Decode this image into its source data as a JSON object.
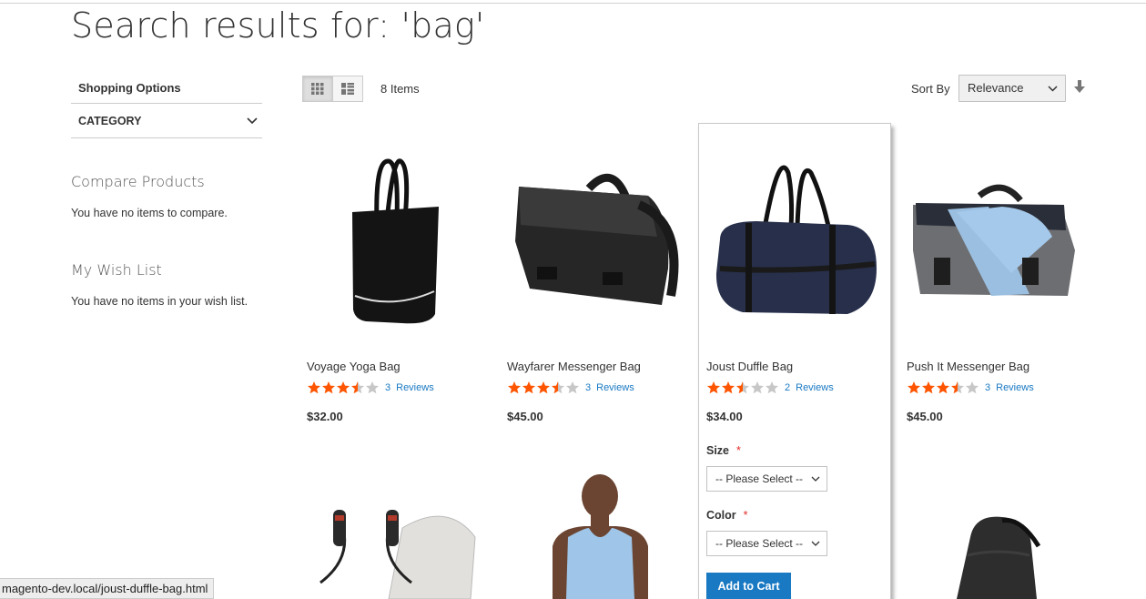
{
  "page": {
    "title": "Search results for: 'bag'"
  },
  "sidebar": {
    "shopping_options": "Shopping Options",
    "category": "CATEGORY",
    "compare": {
      "title": "Compare Products",
      "text": "You have no items to compare."
    },
    "wishlist": {
      "title": "My Wish List",
      "text": "You have no items in your wish list."
    }
  },
  "toolbar": {
    "modes": [
      "grid-icon",
      "list-icon"
    ],
    "count": "8 Items",
    "sort_label": "Sort By",
    "sort_value": "Relevance"
  },
  "products": [
    {
      "name": "Voyage Yoga Bag",
      "rating": 3.5,
      "reviews_count": "3",
      "reviews_label": "Reviews",
      "price": "$32.00",
      "image": "tote-bag"
    },
    {
      "name": "Wayfarer Messenger Bag",
      "rating": 3.5,
      "reviews_count": "3",
      "reviews_label": "Reviews",
      "price": "$45.00",
      "image": "messenger-bag-black"
    },
    {
      "name": "Joust Duffle Bag",
      "rating": 2.5,
      "reviews_count": "2",
      "reviews_label": "Reviews",
      "price": "$34.00",
      "image": "duffle-bag"
    },
    {
      "name": "Push It Messenger Bag",
      "rating": 3.5,
      "reviews_count": "3",
      "reviews_label": "Reviews",
      "price": "$45.00",
      "image": "messenger-bag-blue"
    }
  ],
  "second_row_images": [
    "jump-rope-bag",
    "model-tank-top",
    "",
    "backpack"
  ],
  "options": {
    "size_label": "Size",
    "color_label": "Color",
    "required_mark": "*",
    "placeholder": "-- Please Select --",
    "add_to_cart": "Add to Cart"
  },
  "colors": {
    "star": "#ff5501",
    "star_empty": "#c7c7c7",
    "link": "#1979c3",
    "button": "#1979c3",
    "required": "#e02b27"
  },
  "status_url": "magento-dev.local/joust-duffle-bag.html"
}
